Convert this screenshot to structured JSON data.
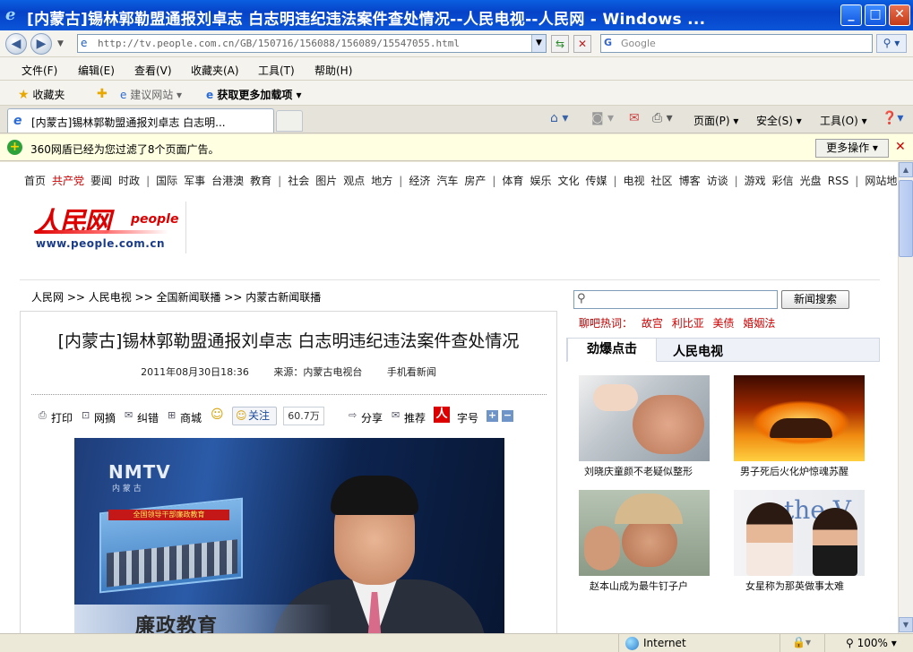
{
  "window": {
    "title": "[内蒙古]锡林郭勒盟通报刘卓志  白志明违纪违法案件查处情况--人民电视--人民网 - Windows ...",
    "minimize": "_",
    "maximize": "□",
    "close": "✕"
  },
  "addressbar": {
    "url": "http://tv.people.com.cn/GB/150716/156088/156089/15547055.html",
    "search_placeholder": "Google"
  },
  "menu": [
    "文件(F)",
    "编辑(E)",
    "查看(V)",
    "收藏夹(A)",
    "工具(T)",
    "帮助(H)"
  ],
  "favorites": {
    "favorites_label": "收藏夹",
    "suggested_sites": "建议网站",
    "get_addons": "获取更多加载项"
  },
  "tab": {
    "label": "[内蒙古]锡林郭勒盟通报刘卓志  白志明..."
  },
  "commandbar": {
    "page": "页面(P)",
    "safety": "安全(S)",
    "tools": "工具(O)"
  },
  "notice": {
    "text": "360网盾已经为您过滤了8个页面广告。",
    "more": "更多操作"
  },
  "site_nav": {
    "groups": [
      [
        "首页",
        "共产党",
        "要闻",
        "时政"
      ],
      [
        "国际",
        "军事",
        "台港澳",
        "教育"
      ],
      [
        "社会",
        "图片",
        "观点",
        "地方"
      ],
      [
        "经济",
        "汽车",
        "房产"
      ],
      [
        "体育",
        "娱乐",
        "文化",
        "传媒"
      ],
      [
        "电视",
        "社区",
        "博客",
        "访谈"
      ],
      [
        "游戏",
        "彩信",
        "光盘",
        "RSS"
      ],
      [
        "网站地图"
      ]
    ]
  },
  "logo": {
    "cn": "人民网",
    "en": "people",
    "url": "www.people.com.cn"
  },
  "breadcrumb": "人民网 >> 人民电视 >> 全国新闻联播 >> 内蒙古新闻联播",
  "article": {
    "title": "[内蒙古]锡林郭勒盟通报刘卓志  白志明违纪违法案件查处情况",
    "date": "2011年08月30日18:36",
    "source": "来源：内蒙古电视台",
    "mobile": "手机看新闻",
    "tools": {
      "print": "打印",
      "excerpt": "网摘",
      "correct": "纠错",
      "shop": "商城",
      "follow": "关注",
      "follow_count": "60.7万",
      "share": "分享",
      "recommend": "推荐",
      "people_mark": "人",
      "font_size": "字号"
    },
    "video": {
      "channel_logo": "NMTV",
      "channel_sub": "内 蒙 古",
      "screen_banner": "全国领导干部廉政教育",
      "caption": "廉政教育"
    }
  },
  "sidebar": {
    "search_button": "新闻搜索",
    "hot_label": "聊吧热词：",
    "hot_words": [
      "故宫",
      "利比亚",
      "美债",
      "婚姻法"
    ],
    "tabs": [
      "劲爆点击",
      "人民电视"
    ],
    "thumbs": [
      {
        "caption": "刘晓庆童颜不老疑似整形"
      },
      {
        "caption": "男子死后火化炉惊魂苏醒"
      },
      {
        "caption": "赵本山成为最牛钉子户"
      },
      {
        "caption": "女星称为那英做事太难"
      }
    ],
    "thumb4_text": "the V"
  },
  "statusbar": {
    "zone": "Internet",
    "zoom": "100%"
  }
}
